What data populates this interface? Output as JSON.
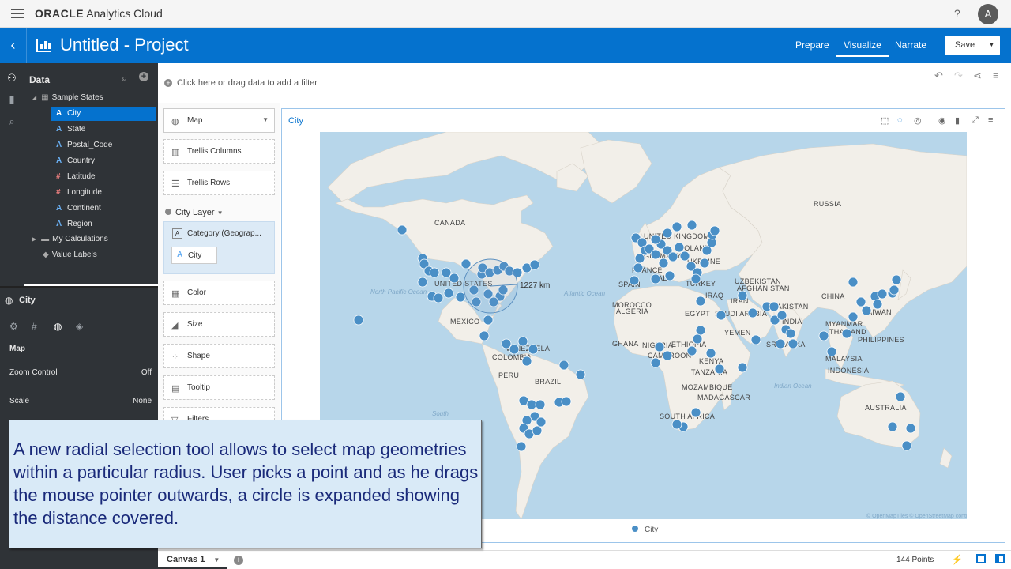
{
  "topbar": {
    "brand_bold": "ORACLE",
    "brand_rest": " Analytics Cloud",
    "help": "?",
    "avatar": "A"
  },
  "project": {
    "title": "Untitled - Project",
    "tabs": [
      "Prepare",
      "Visualize",
      "Narrate"
    ],
    "save": "Save"
  },
  "data_panel": {
    "title": "Data",
    "dataset": "Sample States",
    "columns": [
      {
        "label": "City",
        "type": "attribute"
      },
      {
        "label": "State",
        "type": "attribute"
      },
      {
        "label": "Postal_Code",
        "type": "attribute"
      },
      {
        "label": "Country",
        "type": "attribute"
      },
      {
        "label": "Latitude",
        "type": "measure"
      },
      {
        "label": "Longitude",
        "type": "measure"
      },
      {
        "label": "Continent",
        "type": "attribute"
      },
      {
        "label": "Region",
        "type": "attribute"
      }
    ],
    "my_calculations": "My Calculations",
    "value_labels": "Value Labels"
  },
  "properties": {
    "title": "City",
    "section": "Map",
    "rows": [
      {
        "label": "Zoom Control",
        "value": "Off"
      },
      {
        "label": "Scale",
        "value": "None"
      }
    ]
  },
  "grammar": {
    "viz_type": "Map",
    "trellis_columns": "Trellis Columns",
    "trellis_rows": "Trellis Rows",
    "layer": "City Layer",
    "category_label": "Category (Geograp...",
    "category_value": "City",
    "color": "Color",
    "size": "Size",
    "shape": "Shape",
    "tooltip": "Tooltip",
    "filters": "Filters"
  },
  "filter": {
    "placeholder": "Click here or drag data to add a filter"
  },
  "viz": {
    "title": "City",
    "legend": "City",
    "radius_readout": "1227 km",
    "attribution": "© OpenMapTiles  © OpenStreetMap contributors",
    "map_labels": [
      "CANADA",
      "UNITED STATES OF AMERICA",
      "MEXICO",
      "VENEZUELA",
      "COLOMBIA",
      "PERU",
      "BRAZIL",
      "RUSSIA",
      "UNITED KINGDOM",
      "GERMANY",
      "FRANCE",
      "SPAIN",
      "ITALY",
      "POLAND",
      "UKRAINE",
      "TURKEY",
      "MOROCCO",
      "ALGERIA",
      "EGYPT",
      "IRAQ",
      "IRAN",
      "SAUDI ARABIA",
      "YEMEN",
      "UZBEKISTAN",
      "AFGHANISTAN",
      "PAKISTAN",
      "INDIA",
      "SRI LANKA",
      "CHINA",
      "MYANMAR",
      "THAILAND",
      "TAIWAN",
      "PHILIPPINES",
      "MALAYSIA",
      "INDONESIA",
      "AUSTRALIA",
      "GHANA",
      "NIGERIA",
      "CAMEROON",
      "ETHIOPIA",
      "KENYA",
      "TANZANIA",
      "MOZAMBIQUE",
      "MADAGASCAR",
      "SOUTH AFRICA"
    ],
    "ocean_labels": [
      "North Pacific Ocean",
      "Atlantic Ocean",
      "Indian Ocean",
      "South"
    ]
  },
  "bottom": {
    "canvas_tab": "Canvas 1",
    "points": "144 Points"
  },
  "caption": "A new radial selection tool allows to select map geometries within a particular radius. User picks a point and as he drags the mouse pointer outwards, a circle is expanded showing the distance covered.",
  "colors": {
    "brand_blue": "#0572ce",
    "panel_dark": "#2f3337",
    "point": "#4a8fc6",
    "ocean": "#b7d6ea",
    "land": "#f2efe9"
  }
}
